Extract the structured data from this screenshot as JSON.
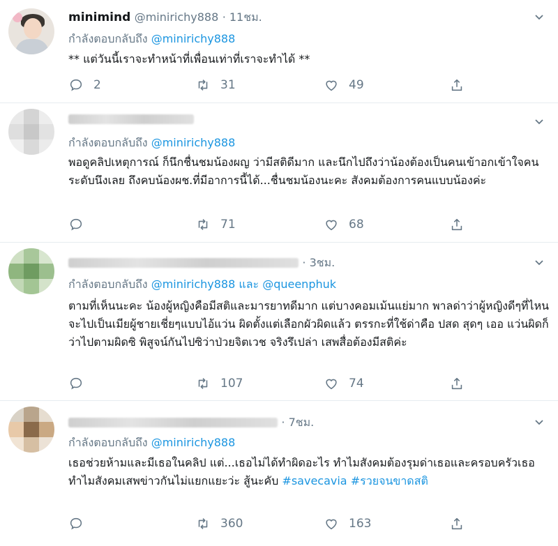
{
  "tweets": [
    {
      "name": "minimind",
      "handle": "@minirichy888",
      "time": "· 11ชม.",
      "reply_prefix": "กำลังตอบกลับถึง",
      "reply_mention": "@minirichy888",
      "reply_and": "",
      "reply_mention2": "",
      "text": "** แต่วันนี้เราจะทำหน้าที่เพื่อนเท่าที่เราจะทำได้ **",
      "replies": "2",
      "retweets": "31",
      "likes": "49"
    },
    {
      "name": "",
      "handle": "",
      "time": "",
      "reply_prefix": "กำลังตอบกลับถึง",
      "reply_mention": "@minirichy888",
      "text": "พอดูคลิปเหตุการณ์ ก็นึกชื่นชมน้องผญ ว่ามีสติดีมาก และนึกไปถึงว่าน้องต้องเป็นคนเข้าอกเข้าใจคนระดับนึงเลย ถึงคบน้องผช.ที่มีอาการนี้ได้...ชื่นชมน้องนะคะ สังคมต้องการคนแบบน้องค่ะ",
      "replies": "",
      "retweets": "71",
      "likes": "68"
    },
    {
      "time": "· 3ชม.",
      "reply_prefix": "กำลังตอบกลับถึง",
      "reply_mention": "@minirichy888",
      "reply_and": "และ",
      "reply_mention2": "@queenphuk",
      "text": "ตามที่เห็นนะคะ น้องผู้หญิงคือมีสติและมารยาทดีมาก แต่บางคอมเม้นแย่มาก พาลด่าว่าผู้หญิงดีๆที่ไหน จะไปเป็นเมียผู้ชายเชี่ยๆแบบไอ้แว่น ผิดตั้งแต่เลือกผัวผิดแล้ว ตรรกะที่ใช้ด่าคือ ปสด สุดๆ เออ แว่นผิดก็ว่าไปตามผิดซิ พิสูจน์กันไปซิว่าป่วยจิตเวช จริงรึเปล่า เสพสื่อต้องมีสติค่ะ",
      "replies": "",
      "retweets": "107",
      "likes": "74"
    },
    {
      "time": "· 7ชม.",
      "reply_prefix": "กำลังตอบกลับถึง",
      "reply_mention": "@minirichy888",
      "text": "เธอช่วยห้ามและมีเธอในคลิป แต่...เธอไม่ได้ทำผิดอะไร ทำไมสังคมต้องรุมด่าเธอและครอบครัวเธอ ทำไมสังคมเสพข่าวกันไม่แยกแยะว่ะ สู้นะคับ ",
      "hashtag1": "#savecavia",
      "hashtag2": "#รวยจนขาดสติ",
      "replies": "",
      "retweets": "360",
      "likes": "163"
    }
  ],
  "colors": {
    "link": "#1b95e0",
    "muted": "#657786",
    "text": "#14171a"
  }
}
